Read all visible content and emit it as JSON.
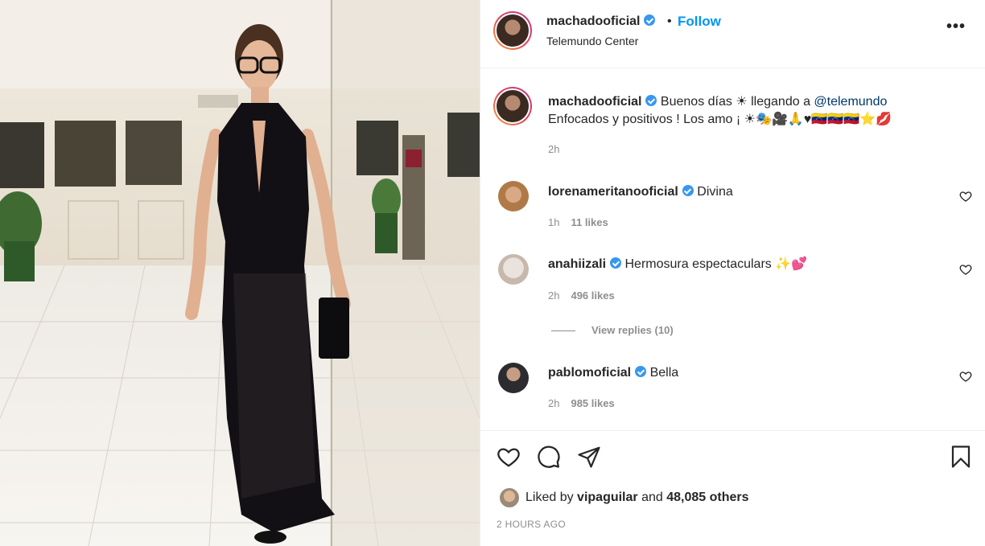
{
  "post": {
    "username": "machadooficial",
    "follow_label": "Follow",
    "separator": "•",
    "location": "Telemundo Center",
    "more_label": "•••"
  },
  "caption": {
    "username": "machadooficial",
    "text_before_mention": " Buenos días ☀ llegando a ",
    "mention": "@telemundo",
    "text_after_mention": " Enfocados y positivos ! Los amo ¡ ☀🎭🎥🙏♥🇻🇪🇻🇪🇻🇪⭐💋",
    "time": "2h"
  },
  "comments": [
    {
      "username": "lorenameritanooficial",
      "text": "Divina",
      "time": "1h",
      "likes": "11 likes"
    },
    {
      "username": "anahiizali",
      "text": "Hermosura espectaculars ✨💕",
      "time": "2h",
      "likes": "496 likes",
      "replies": "View replies (10)"
    },
    {
      "username": "pablomoficial",
      "text": "Bella",
      "time": "2h",
      "likes": "985 likes"
    }
  ],
  "likes": {
    "prefix": "Liked by ",
    "user": "vipaguilar",
    "middle": " and ",
    "count": "48,085 others"
  },
  "timestamp": "2 HOURS AGO",
  "colors": {
    "accent": "#0095f6",
    "verified": "#3897f0",
    "muted": "#8e8e8e",
    "text": "#262626"
  },
  "icons": [
    "verified-badge-icon",
    "more-options-icon",
    "heart-icon",
    "comment-icon",
    "share-icon",
    "bookmark-icon"
  ]
}
